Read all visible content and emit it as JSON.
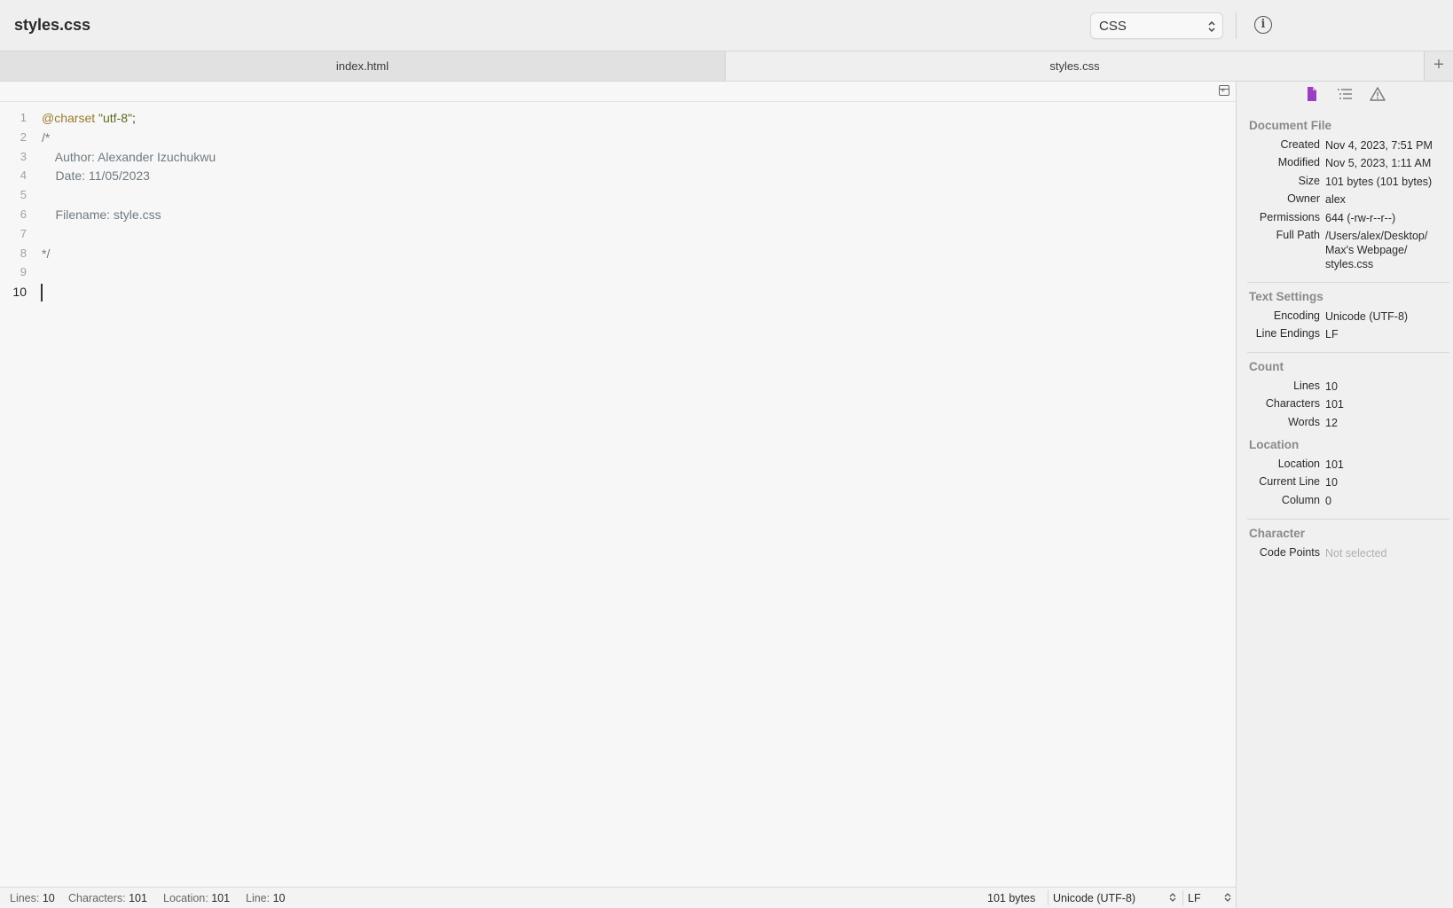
{
  "window": {
    "title": "styles.css",
    "syntax": "CSS"
  },
  "tabs": [
    {
      "label": "index.html"
    },
    {
      "label": "styles.css"
    }
  ],
  "editor": {
    "line_numbers": [
      "1",
      "2",
      "3",
      "4",
      "5",
      "6",
      "7",
      "8",
      "9",
      "10"
    ],
    "current_line": "10",
    "lines": {
      "l1_keyword": "@charset",
      "l1_string": "\"utf-8\"",
      "l1_punct": ";",
      "l2": "/*",
      "l3": "    Author: Alexander Izuchukwu",
      "l4": "    Date: 11/05/2023",
      "l5": "",
      "l6": "    Filename: style.css",
      "l7": "",
      "l8": "*/",
      "l9": "",
      "l10": ""
    }
  },
  "statusbar": {
    "lines_label": "Lines:",
    "lines_value": "10",
    "chars_label": "Characters:",
    "chars_value": "101",
    "location_label": "Location:",
    "location_value": "101",
    "line_label": "Line:",
    "line_value": "10",
    "size": "101 bytes",
    "encoding": "Unicode (UTF-8)",
    "line_ending": "LF"
  },
  "inspector": {
    "document_file": {
      "title": "Document File",
      "created_label": "Created",
      "created": "Nov 4, 2023, 7:51 PM",
      "modified_label": "Modified",
      "modified": "Nov 5, 2023, 1:11 AM",
      "size_label": "Size",
      "size": "101 bytes (101 bytes)",
      "owner_label": "Owner",
      "owner": "alex",
      "permissions_label": "Permissions",
      "permissions": "644 (-rw-r--r--)",
      "path_label": "Full Path",
      "path_1": "/Users/alex/Desktop/",
      "path_2": "Max's Webpage/",
      "path_3": "styles.css"
    },
    "text_settings": {
      "title": "Text Settings",
      "encoding_label": "Encoding",
      "encoding": "Unicode (UTF-8)",
      "line_endings_label": "Line Endings",
      "line_endings": "LF"
    },
    "count": {
      "title": "Count",
      "lines_label": "Lines",
      "lines": "10",
      "characters_label": "Characters",
      "characters": "101",
      "words_label": "Words",
      "words": "12"
    },
    "location": {
      "title": "Location",
      "location_label": "Location",
      "location": "101",
      "current_line_label": "Current Line",
      "current_line": "10",
      "column_label": "Column",
      "column": "0"
    },
    "character": {
      "title": "Character",
      "code_points_label": "Code Points",
      "code_points": "Not selected"
    }
  },
  "colors": {
    "accent_purple": "#9b3fc2",
    "keyword": "#9a7a2c",
    "string": "#5a6b1f"
  }
}
